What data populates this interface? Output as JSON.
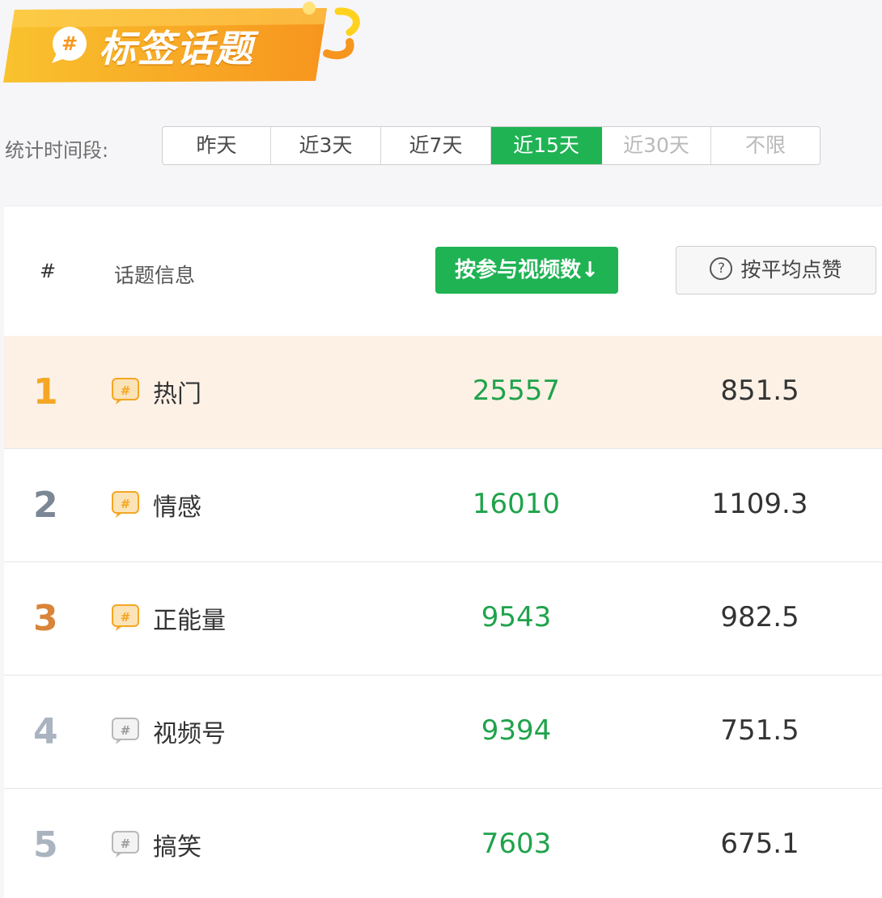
{
  "banner": {
    "title": "标签话题",
    "badge_glyph": "#",
    "gradient_start": "#f9c22e",
    "gradient_end": "#f7951e"
  },
  "filter": {
    "label": "统计时间段:",
    "options": [
      "昨天",
      "近3天",
      "近7天",
      "近15天",
      "近30天",
      "不限"
    ],
    "selected": "近15天",
    "disabled": [
      "近30天",
      "不限"
    ]
  },
  "table": {
    "header": {
      "rank": "#",
      "topic": "话题信息",
      "sort_videos": "按参与视频数",
      "sort_videos_arrow": "↓",
      "sort_likes": "按平均点赞",
      "help_glyph": "?"
    },
    "rows": [
      {
        "rank": "1",
        "name": "热门",
        "videos": "25557",
        "likes": "851.5",
        "icon": "hashtag-bubble-icon",
        "icon_color": "#f5a623"
      },
      {
        "rank": "2",
        "name": "情感",
        "videos": "16010",
        "likes": "1109.3",
        "icon": "hashtag-bubble-icon",
        "icon_color": "#f5a623"
      },
      {
        "rank": "3",
        "name": "正能量",
        "videos": "9543",
        "likes": "982.5",
        "icon": "hashtag-bubble-icon",
        "icon_color": "#f5a623"
      },
      {
        "rank": "4",
        "name": "视频号",
        "videos": "9394",
        "likes": "751.5",
        "icon": "hashtag-bubble-icon",
        "icon_color": "#b8b8b8"
      },
      {
        "rank": "5",
        "name": "搞笑",
        "videos": "7603",
        "likes": "675.1",
        "icon": "hashtag-bubble-icon",
        "icon_color": "#b8b8b8"
      }
    ]
  },
  "colors": {
    "accent_green": "#1fb354",
    "value_green": "#1fa34b",
    "top_row_bg": "#fdf1e6"
  }
}
